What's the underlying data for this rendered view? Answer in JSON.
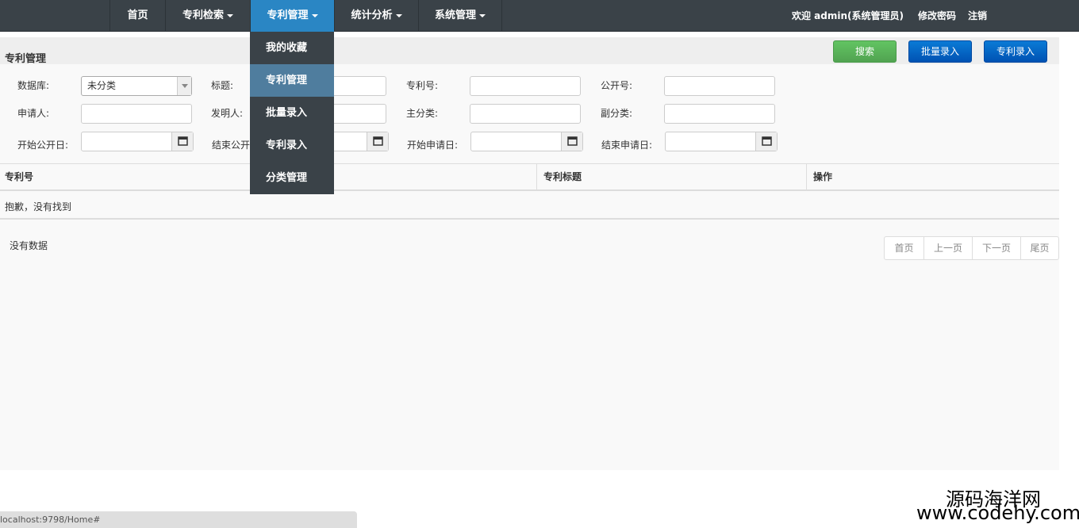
{
  "nav": {
    "items": [
      "首页",
      "专利检索",
      "专利管理",
      "统计分析",
      "系统管理"
    ],
    "welcome": "欢迎 admin(系统管理员)",
    "change_password": "修改密码",
    "logout": "注销"
  },
  "dropdown": {
    "items": [
      "我的收藏",
      "专利管理",
      "批量录入",
      "专利录入",
      "分类管理"
    ]
  },
  "panel": {
    "title": "专利管理",
    "search_btn": "搜索",
    "batch_btn": "批量录入",
    "entry_btn": "专利录入"
  },
  "form": {
    "database_label": "数据库:",
    "database_value": "未分类",
    "title_label": "标题:",
    "patent_no_label": "专利号:",
    "pub_no_label": "公开号:",
    "applicant_label": "申请人:",
    "inventor_label": "发明人:",
    "main_class_label": "主分类:",
    "sub_class_label": "副分类:",
    "start_pub_label": "开始公开日:",
    "end_pub_label": "结束公开",
    "start_app_label": "开始申请日:",
    "end_app_label": "结束申请日:"
  },
  "table": {
    "columns": [
      "专利号",
      "专利标题",
      "操作"
    ],
    "empty_text": "抱歉，没有找到"
  },
  "footer": {
    "no_data": "没有数据",
    "pager": [
      "首页",
      "上一页",
      "下一页",
      "尾页"
    ]
  },
  "status_url": "localhost:9798/Home#",
  "watermark": {
    "line1": "源码海洋网",
    "line2": "www.codehy.com"
  },
  "colors": {
    "navbar": "#3a4248",
    "active_nav": "#2a86c4",
    "search_btn": "#51a351",
    "primary_btn": "#0052b3"
  }
}
